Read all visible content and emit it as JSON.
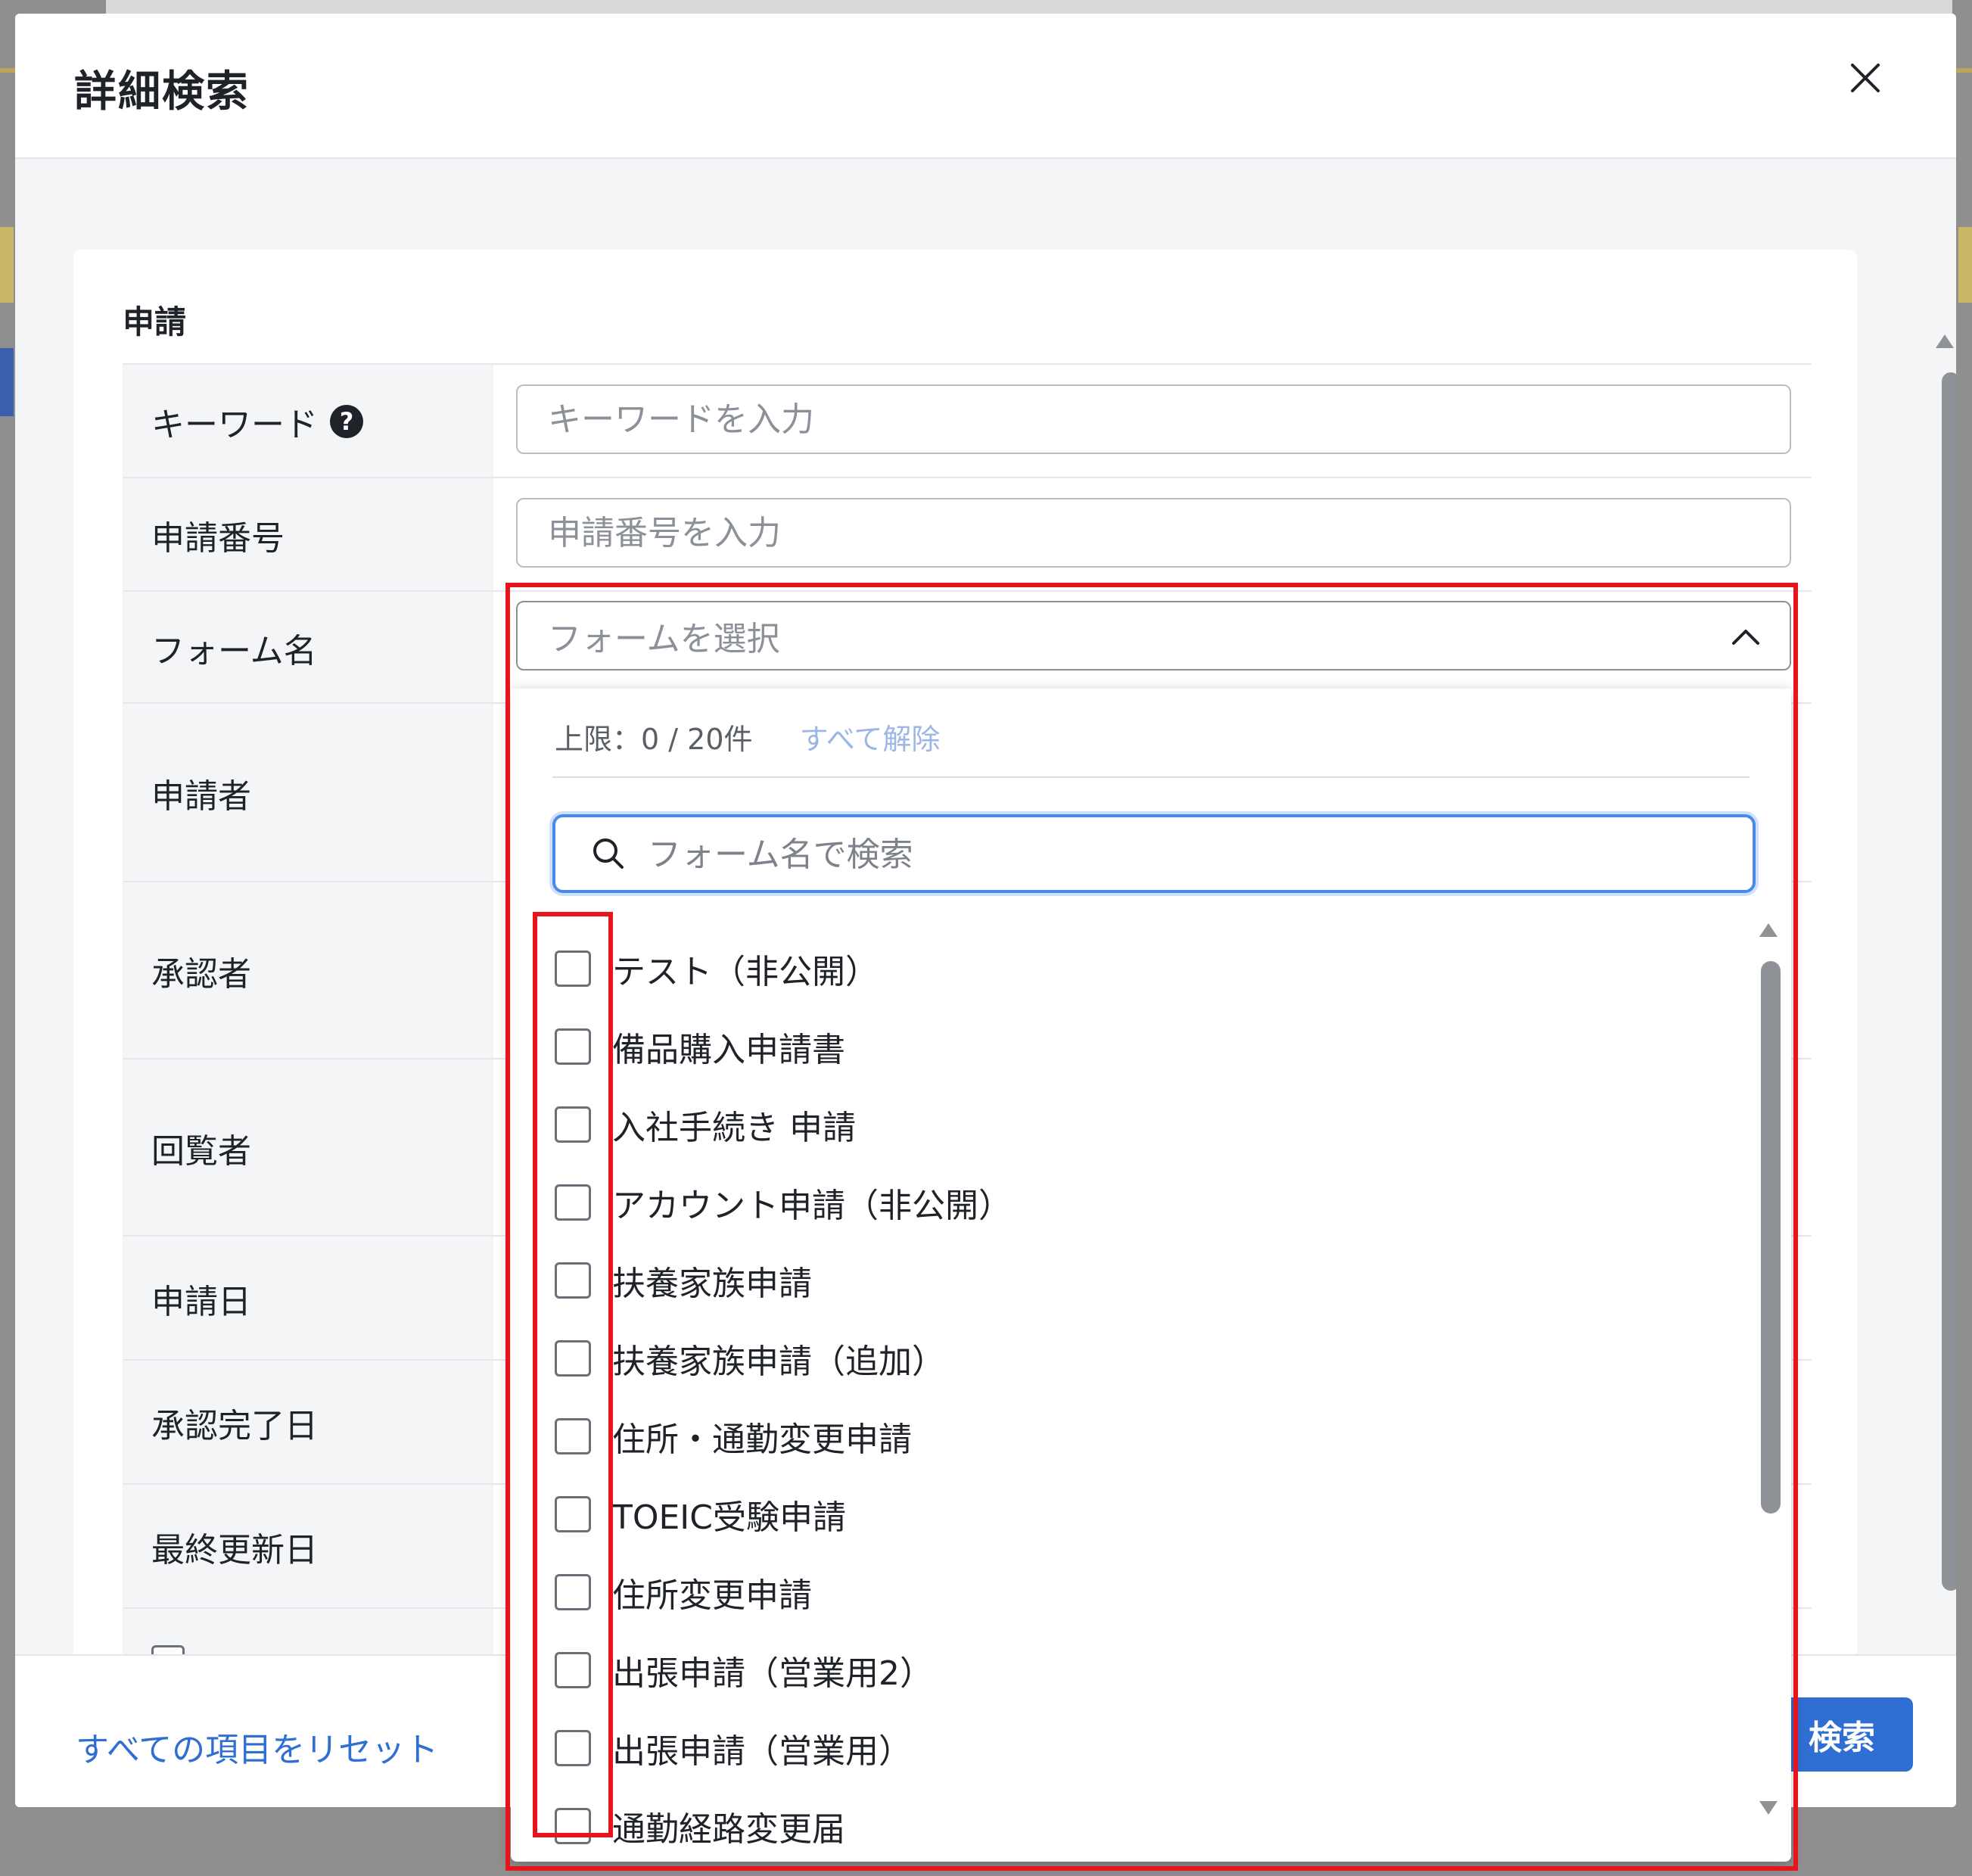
{
  "modal": {
    "title": "詳細検索",
    "close_icon": "close-icon"
  },
  "section": {
    "title": "申請"
  },
  "fields": {
    "keyword": {
      "label": "キーワード",
      "help": "?",
      "placeholder": "キーワードを入力",
      "value": ""
    },
    "application_number": {
      "label": "申請番号",
      "placeholder": "申請番号を入力",
      "value": ""
    },
    "form_name": {
      "label": "フォーム名",
      "placeholder": "フォームを選択",
      "value": ""
    },
    "applicant": {
      "label": "申請者"
    },
    "approver": {
      "label": "承認者"
    },
    "viewer": {
      "label": "回覧者"
    },
    "application_date": {
      "label": "申請日"
    },
    "approval_complete_date": {
      "label": "承認完了日"
    },
    "last_updated": {
      "label": "最終更新日"
    },
    "reflect_error": {
      "label": "反映エラー"
    }
  },
  "dropdown": {
    "limit_text": "上限：0 / 20件",
    "clear_all": "すべて解除",
    "search_placeholder": "フォーム名で検索",
    "options": [
      {
        "label": "テスト（非公開）",
        "checked": false
      },
      {
        "label": "備品購入申請書",
        "checked": false
      },
      {
        "label": "入社手続き 申請",
        "checked": false
      },
      {
        "label": "アカウント申請（非公開）",
        "checked": false
      },
      {
        "label": "扶養家族申請",
        "checked": false
      },
      {
        "label": "扶養家族申請（追加）",
        "checked": false
      },
      {
        "label": "住所・通勤変更申請",
        "checked": false
      },
      {
        "label": "TOEIC受験申請",
        "checked": false
      },
      {
        "label": "住所変更申請",
        "checked": false
      },
      {
        "label": "出張申請（営業用2）",
        "checked": false
      },
      {
        "label": "出張申請（営業用）",
        "checked": false
      },
      {
        "label": "通勤経路変更届",
        "checked": false
      }
    ]
  },
  "footer": {
    "reset_label": "すべての項目をリセット",
    "search_label": "検索"
  },
  "colors": {
    "accent": "#2f6fd3",
    "highlight": "#e8141c",
    "focus_border": "#4a8ae6"
  }
}
